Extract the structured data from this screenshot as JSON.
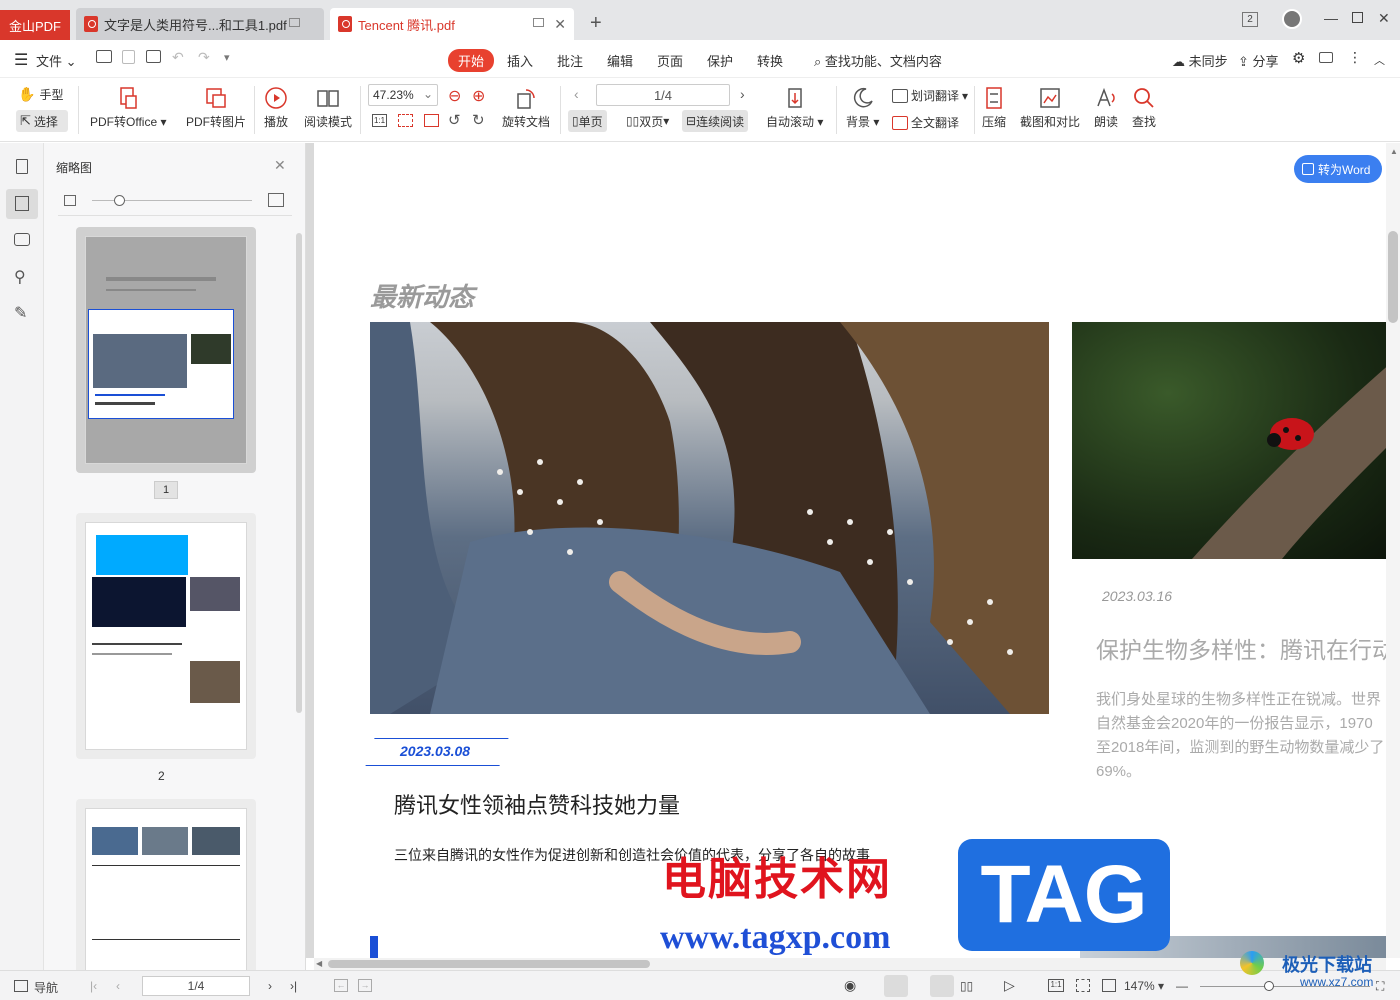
{
  "tabs": {
    "app": "金山PDF",
    "doc1": "文字是人类用符号...和工具1.pdf",
    "doc2": "Tencent 腾讯.pdf",
    "badge": "2"
  },
  "menu": {
    "file": "文件",
    "items": [
      "开始",
      "插入",
      "批注",
      "编辑",
      "页面",
      "保护",
      "转换"
    ],
    "search": "查找功能、文档内容",
    "sync": "未同步",
    "share": "分享"
  },
  "toolbar": {
    "hand": "手型",
    "select": "选择",
    "pdf_to_office": "PDF转Office",
    "pdf_to_image": "PDF转图片",
    "play": "播放",
    "read_mode": "阅读模式",
    "zoom": "47.23%",
    "rotate": "旋转文档",
    "page": "1/4",
    "single": "单页",
    "double": "双页",
    "continuous": "连续阅读",
    "autoscroll": "自动滚动",
    "background": "背景",
    "word_translate": "划词翻译",
    "full_translate": "全文翻译",
    "compress": "压缩",
    "screenshot_compare": "截图和对比",
    "read_aloud": "朗读",
    "find": "查找"
  },
  "thumbs": {
    "title": "缩略图",
    "pages": [
      "1",
      "2"
    ]
  },
  "document": {
    "to_word": "转为Word",
    "section_title": "最新动态",
    "date1": "2023.03.08",
    "headline1": "腾讯女性领袖点赞科技她力量",
    "body1": "三位来自腾讯的女性作为促进创新和创造社会价值的代表，分享了各自的故事",
    "date2": "2023.03.16",
    "headline2": "保护生物多样性：腾讯在行动",
    "body2_lines": [
      "我们身处星球的生物多样性正在锐减。世界",
      "自然基金会2020年的一份报告显示，1970",
      "至2018年间，监测到的野生动物数量减少了",
      "69%。"
    ]
  },
  "watermark": {
    "cn": "电脑技术网",
    "tag": "TAG",
    "url": "www.tagxp.com",
    "site": "极光下载站",
    "site_url": "www.xz7.com"
  },
  "status": {
    "nav": "导航",
    "page": "1/4",
    "zoom": "147%"
  },
  "colors": {
    "brand_red": "#d9372b",
    "accent_blue": "#1a4fd6",
    "word_btn": "#3b7ff0"
  }
}
